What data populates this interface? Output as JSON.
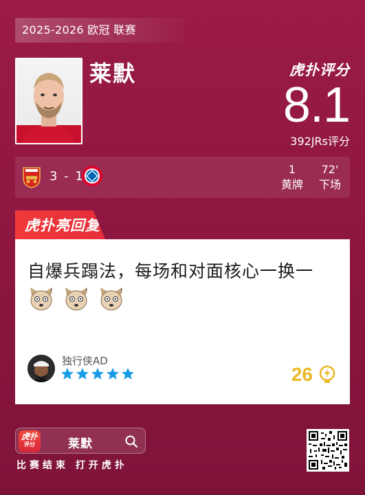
{
  "header": {
    "season": "2025-2026 欧冠 联赛"
  },
  "player": {
    "name": "莱默"
  },
  "rating": {
    "brand": "虎扑评分",
    "score": "8.1",
    "count": "392JRs评分"
  },
  "match": {
    "score": "3 - 1",
    "home_crest": "arsenal-crest",
    "away_crest": "bayern-crest",
    "stats": [
      {
        "value": "1",
        "label": "黄牌"
      },
      {
        "value": "72'",
        "label": "下场"
      }
    ]
  },
  "comment": {
    "ribbon": "虎扑亮回复",
    "text": "自爆兵蹋法，每场和对面核心一换一",
    "emoji_count": 3,
    "emoji_icon": "husky-emoji",
    "user": "独行侠AD",
    "stars": 5,
    "likes": "26",
    "like_icon": "lightbulb-icon"
  },
  "footer": {
    "app_icon_text": "虎扑",
    "app_icon_sub": "评分",
    "search_term": "莱默",
    "slogan": "比赛结束 打开虎扑"
  },
  "colors": {
    "background": "#8c1640",
    "ribbon": "#e52e3a",
    "stars": "#1a9be8",
    "likes": "#e9b824"
  }
}
